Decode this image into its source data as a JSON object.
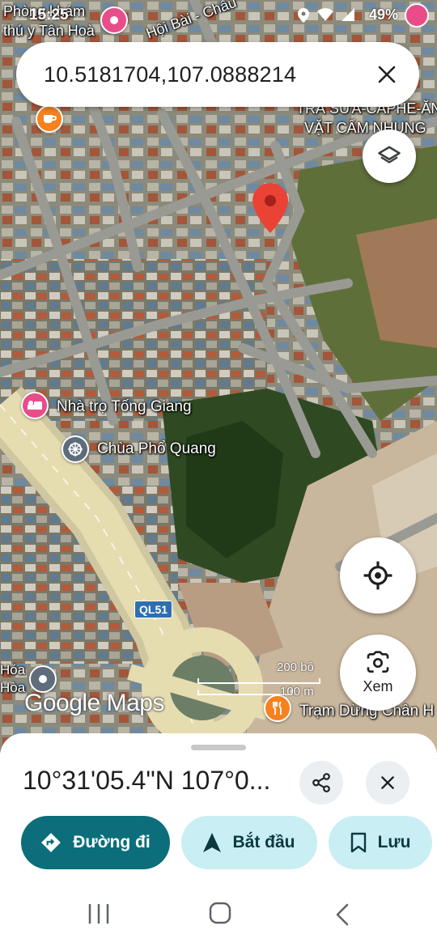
{
  "status_bar": {
    "time": "15:25",
    "battery": "49%"
  },
  "search": {
    "value": "10.5181704,107.0888214"
  },
  "map": {
    "labels": {
      "top_left_1": "Phòng khám",
      "top_left_2": "thú y Tân Hoà",
      "road_top": "Hội Bài - Châu",
      "cafe_1": "TRÀ SỮA-CAPHE-ĂN",
      "cafe_2": "VẶT CẨM NHUNG",
      "hotel": "Nhà trọ Tống Giang",
      "temple": "Chùa Phổ Quang",
      "highway": "QL51",
      "restaurant": "Trạm Dừng Chân H",
      "left_edge_1": "Hóa",
      "left_edge_2": "Hòa",
      "scale_ft": "200 bộ",
      "scale_m": "100 m"
    },
    "logo": "Google Maps",
    "lens_label": "Xem"
  },
  "sheet": {
    "coordinates": "10°31'05.4\"N 107°0...",
    "directions_label": "Đường đi",
    "start_label": "Bắt đầu",
    "save_label": "Lưu"
  },
  "colors": {
    "accent": "#0b6e7a",
    "chip_secondary": "#c9eef4",
    "pin": "#ea4335",
    "hotel_icon": "#e84d8a",
    "food_icon": "#f5811f"
  },
  "icons": [
    "layers-icon",
    "my-location-icon",
    "lens-icon",
    "share-icon",
    "close-icon",
    "directions-icon",
    "navigation-icon",
    "bookmark-icon"
  ]
}
